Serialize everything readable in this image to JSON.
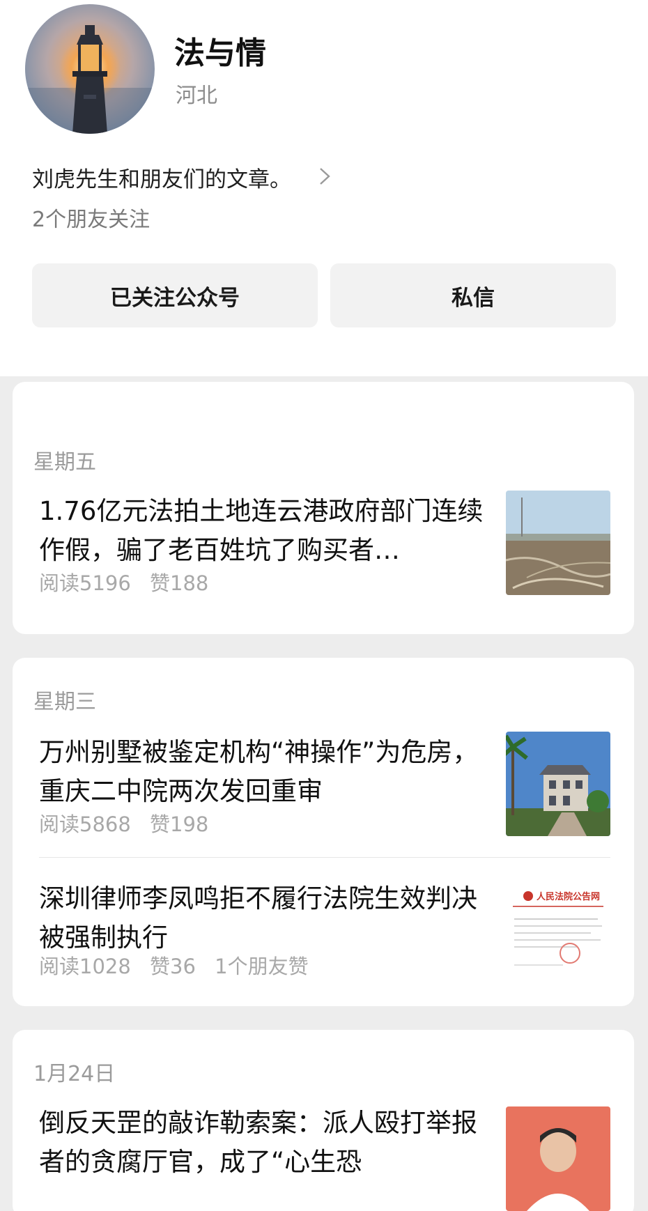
{
  "profile": {
    "name": "法与情",
    "region": "河北",
    "intro": "刘虎先生和朋友们的文章。",
    "friends_following": "2个朋友关注"
  },
  "actions": {
    "follow_label": "已关注公众号",
    "message_label": "私信"
  },
  "feed": [
    {
      "date": "星期五",
      "articles": [
        {
          "title": "1.76亿元法拍土地连云港政府部门连续作假，骗了老百姓坑了购买者…",
          "reads": "阅读5196",
          "likes": "赞188",
          "friend_likes": ""
        }
      ]
    },
    {
      "date": "星期三",
      "articles": [
        {
          "title": "万州别墅被鉴定机构“神操作”为危房，重庆二中院两次发回重审",
          "reads": "阅读5868",
          "likes": "赞198",
          "friend_likes": ""
        },
        {
          "title": "深圳律师李凤鸣拒不履行法院生效判决被强制执行",
          "reads": "阅读1028",
          "likes": "赞36",
          "friend_likes": "1个朋友赞",
          "thumb_caption": "人民法院公告网"
        }
      ]
    },
    {
      "date": "1月24日",
      "articles": [
        {
          "title": "倒反天罡的敲诈勒索案：派人殴打举报者的贪腐厅官，成了“心生恐",
          "reads": "",
          "likes": "",
          "friend_likes": ""
        }
      ]
    }
  ],
  "icons": {
    "avatar": "lighthouse-avatar",
    "intro_more": "chevron-right-icon"
  }
}
